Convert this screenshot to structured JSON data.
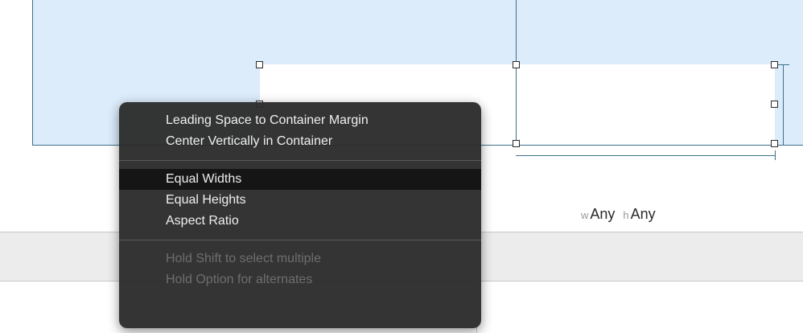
{
  "canvas": {
    "size_class": {
      "w_label": "w",
      "w_value": "Any",
      "h_label": "h",
      "h_value": "Any"
    }
  },
  "context_menu": {
    "groups": [
      [
        "Leading Space to Container Margin",
        "Center Vertically in Container"
      ],
      [
        "Equal Widths",
        "Equal Heights",
        "Aspect Ratio"
      ],
      [
        "Hold Shift to select multiple",
        "Hold Option for alternates"
      ]
    ],
    "highlighted": "Equal Widths",
    "disabled": [
      "Hold Shift to select multiple",
      "Hold Option for alternates"
    ]
  },
  "colors": {
    "canvas_background": "#dcecfb",
    "constraint_line": "#3e6f8a",
    "menu_background": "#2c2c2c",
    "menu_highlight": "#151515",
    "menu_text": "#f0f0f0",
    "menu_disabled_text": "#6e6e6e"
  }
}
